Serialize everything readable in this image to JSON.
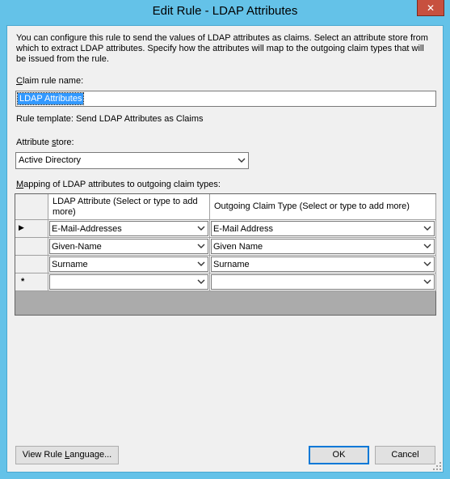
{
  "window": {
    "title": "Edit Rule - LDAP Attributes",
    "close_icon": "✕"
  },
  "description": "You can configure this rule to send the values of LDAP attributes as claims. Select an attribute store from which to extract LDAP attributes. Specify how the attributes will map to the outgoing claim types that will be issued from the rule.",
  "claim_rule_name": {
    "label_key": "C",
    "label_rest": "laim rule name:",
    "value": "LDAP Attributes"
  },
  "rule_template": "Rule template: Send LDAP Attributes as Claims",
  "attribute_store": {
    "label_pre": "Attribute ",
    "label_key": "s",
    "label_rest": "tore:",
    "value": "Active Directory"
  },
  "mapping": {
    "label_key": "M",
    "label_rest": "apping of LDAP attributes to outgoing claim types:",
    "col_ldap": "LDAP Attribute (Select or type to add more)",
    "col_claim": "Outgoing Claim Type (Select or type to add more)",
    "rows": [
      {
        "marker": "▶",
        "ldap": "E-Mail-Addresses",
        "claim": "E-Mail Address"
      },
      {
        "marker": "",
        "ldap": "Given-Name",
        "claim": "Given Name"
      },
      {
        "marker": "",
        "ldap": "Surname",
        "claim": "Surname"
      },
      {
        "marker": "*",
        "ldap": "",
        "claim": ""
      }
    ]
  },
  "buttons": {
    "view_pre": "View Rule ",
    "view_key": "L",
    "view_rest": "anguage...",
    "ok": "OK",
    "cancel": "Cancel"
  },
  "icons": {
    "close": "close-icon",
    "dropdown": "chevron-down-icon",
    "current_row": "row-pointer-icon",
    "new_row": "new-row-icon",
    "resize": "resize-grip-icon"
  },
  "colors": {
    "title_bar": "#64c2e8",
    "close_button": "#c7503f",
    "selection": "#3399ff",
    "default_button_border": "#0078d7"
  }
}
